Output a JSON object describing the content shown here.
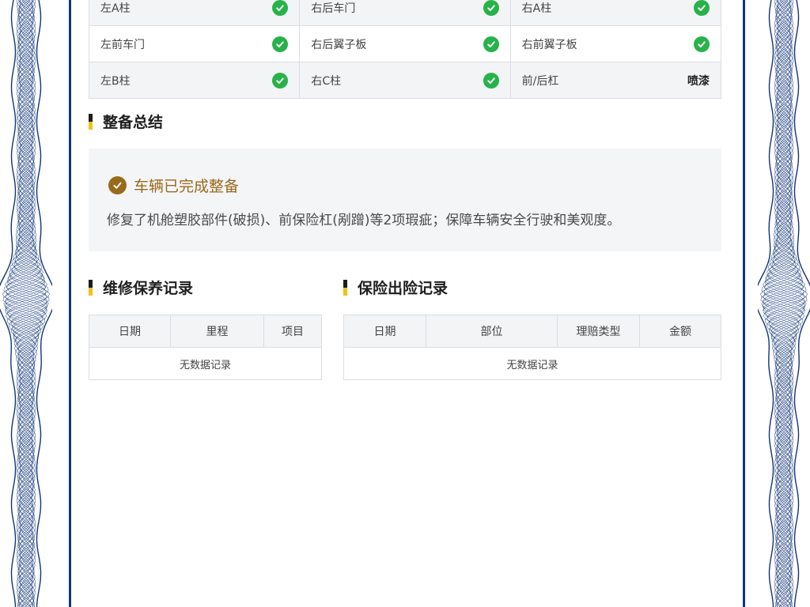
{
  "inspection": {
    "rows": [
      [
        {
          "name": "左A柱",
          "status": "ok"
        },
        {
          "name": "右后车门",
          "status": "ok"
        },
        {
          "name": "右A柱",
          "status": "ok"
        }
      ],
      [
        {
          "name": "左前车门",
          "status": "ok"
        },
        {
          "name": "右后翼子板",
          "status": "ok"
        },
        {
          "name": "右前翼子板",
          "status": "ok"
        }
      ],
      [
        {
          "name": "左B柱",
          "status": "ok"
        },
        {
          "name": "右C柱",
          "status": "ok"
        },
        {
          "name": "前/后杠",
          "status": "text",
          "text": "喷漆"
        }
      ]
    ]
  },
  "summary": {
    "title": "整备总结",
    "status": "车辆已完成整备",
    "text": "修复了机舱塑胶部件(破损)、前保险杠(剐蹭)等2项瑕疵；保障车辆安全行驶和美观度。"
  },
  "maintenance": {
    "title": "维修保养记录",
    "headers": [
      "日期",
      "里程",
      "项目"
    ],
    "empty": "无数据记录"
  },
  "insurance": {
    "title": "保险出险记录",
    "headers": [
      "日期",
      "部位",
      "理赔类型",
      "金额"
    ],
    "empty": "无数据记录"
  },
  "colors": {
    "frame": "#12357a",
    "check": "#27b24a",
    "accent": "#9a6a1c",
    "title_bar_top": "#1d1d1d",
    "title_bar_bottom": "#f0c11b"
  },
  "icons": {
    "check": "check-circle-icon",
    "status": "check-badge-icon"
  }
}
